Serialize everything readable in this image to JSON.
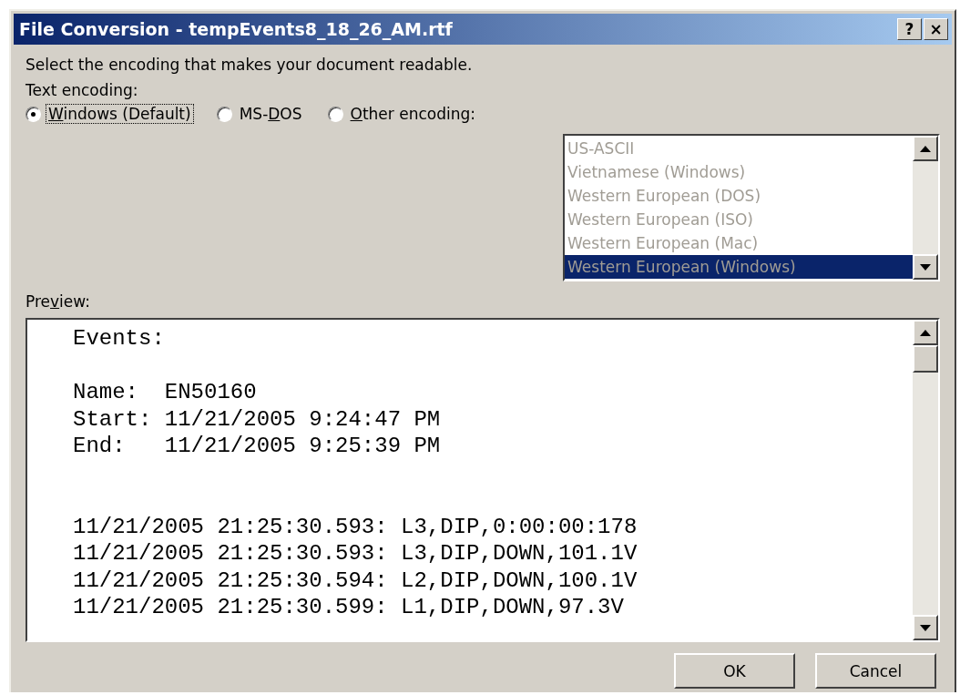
{
  "window": {
    "title": "File Conversion - tempEvents8_18_26_AM.rtf",
    "title_buttons": [
      "?",
      "×"
    ]
  },
  "instruction": "Select the encoding that makes your document readable.",
  "encoding_label": "Text encoding:",
  "encodings": [
    {
      "label": [
        {
          "text": "W",
          "underlined": true
        },
        {
          "text": "indows (Default)",
          "underlined": false
        }
      ],
      "selected": true,
      "focused": true
    },
    {
      "label": [
        {
          "text": "MS-",
          "underlined": false
        },
        {
          "text": "D",
          "underlined": true
        },
        {
          "text": "OS",
          "underlined": false
        }
      ],
      "selected": false,
      "focused": false
    },
    {
      "label": [
        {
          "text": "O",
          "underlined": true
        },
        {
          "text": "ther encoding:",
          "underlined": false
        }
      ],
      "selected": false,
      "focused": false
    }
  ],
  "encoding_list": {
    "disabled": true,
    "items": [
      {
        "label": "US-ASCII",
        "selected": false
      },
      {
        "label": "Vietnamese (Windows)",
        "selected": false
      },
      {
        "label": "Western European (DOS)",
        "selected": false
      },
      {
        "label": "Western European (ISO)",
        "selected": false
      },
      {
        "label": "Western European (Mac)",
        "selected": false
      },
      {
        "label": "Western European (Windows)",
        "selected": true
      }
    ]
  },
  "preview": {
    "label": [
      {
        "text": "Pre",
        "underlined": false
      },
      {
        "text": "v",
        "underlined": true
      },
      {
        "text": "iew:",
        "underlined": false
      }
    ],
    "text": "Events:\n\nName:  EN50160\nStart: 11/21/2005 9:24:47 PM\nEnd:   11/21/2005 9:25:39 PM\n\n\n11/21/2005 21:25:30.593: L3,DIP,0:00:00:178\n11/21/2005 21:25:30.593: L3,DIP,DOWN,101.1V\n11/21/2005 21:25:30.594: L2,DIP,DOWN,100.1V\n11/21/2005 21:25:30.599: L1,DIP,DOWN,97.3V"
  },
  "buttons": [
    "OK",
    "Cancel"
  ]
}
